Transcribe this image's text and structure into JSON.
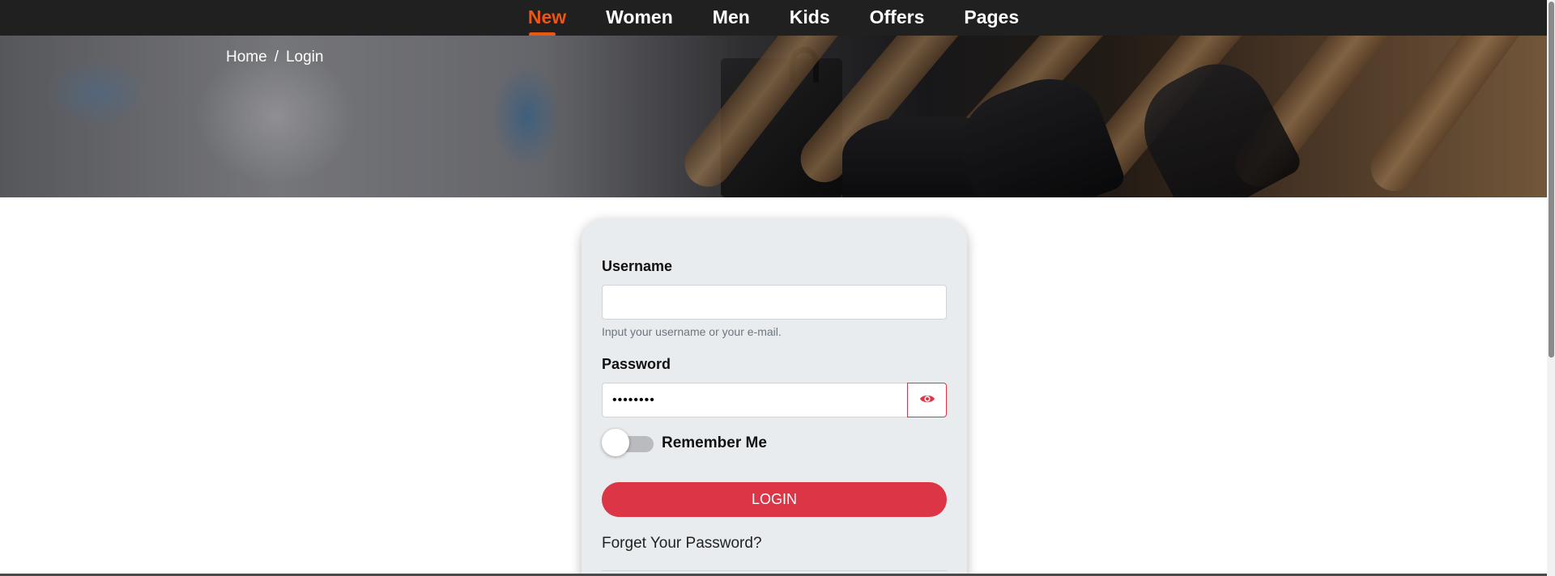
{
  "nav": {
    "items": [
      {
        "label": "New",
        "active": true
      },
      {
        "label": "Women",
        "active": false
      },
      {
        "label": "Men",
        "active": false
      },
      {
        "label": "Kids",
        "active": false
      },
      {
        "label": "Offers",
        "active": false
      },
      {
        "label": "Pages",
        "active": false
      }
    ]
  },
  "breadcrumb": {
    "home": "Home",
    "separator": "/",
    "current": "Login"
  },
  "form": {
    "username_label": "Username",
    "username_value": "",
    "username_help": "Input your username or your e-mail.",
    "password_label": "Password",
    "password_value": "••••••••",
    "remember_label": "Remember Me",
    "remember_checked": false,
    "login_label": "LOGIN",
    "forget_label": "Forget Your Password?"
  },
  "colors": {
    "accent": "#ee5511",
    "primary_button": "#dc3545",
    "nav_bg": "#202020",
    "card_bg": "#e9ecef"
  },
  "icons": {
    "password_toggle": "eye-icon"
  }
}
